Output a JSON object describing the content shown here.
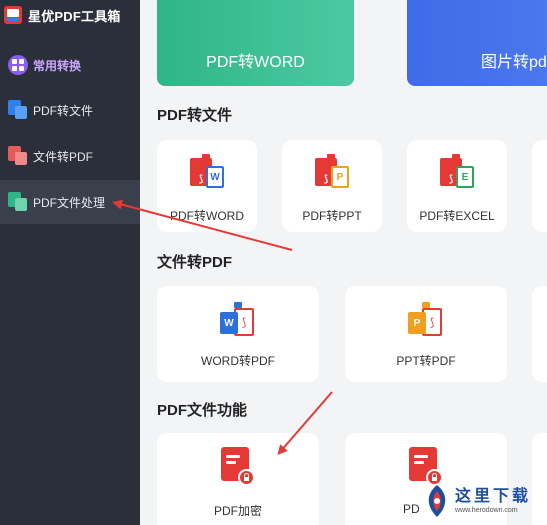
{
  "app": {
    "title": "星优PDF工具箱"
  },
  "sidebar": {
    "items": [
      {
        "label": "常用转换",
        "icon": "grid-icon"
      },
      {
        "label": "PDF转文件",
        "icon": "pdf-to-file-icon"
      },
      {
        "label": "文件转PDF",
        "icon": "file-to-pdf-icon"
      },
      {
        "label": "PDF文件处理",
        "icon": "pdf-process-icon"
      }
    ],
    "selected_index": 3
  },
  "banners": [
    {
      "label": "PDF转WORD",
      "color": "#2fb587"
    },
    {
      "label": "图片转pd",
      "color": "#3f6be8"
    }
  ],
  "sections": {
    "pdf_to_file": {
      "title": "PDF转文件",
      "cards": [
        {
          "label": "PDF转WORD",
          "badge": "W",
          "badge_color": "#2f6fd9"
        },
        {
          "label": "PDF转PPT",
          "badge": "P",
          "badge_color": "#f0a020"
        },
        {
          "label": "PDF转EXCEL",
          "badge": "E",
          "badge_color": "#2fa35a"
        }
      ]
    },
    "file_to_pdf": {
      "title": "文件转PDF",
      "cards": [
        {
          "label": "WORD转PDF",
          "badge": "W",
          "badge_color": "#2f6fd9"
        },
        {
          "label": "PPT转PDF",
          "badge": "P",
          "badge_color": "#f0a020"
        }
      ]
    },
    "pdf_functions": {
      "title": "PDF文件功能",
      "cards": [
        {
          "label": "PDF加密",
          "icon": "lock-doc-icon"
        },
        {
          "label": "PD",
          "icon": "key-doc-icon"
        }
      ]
    }
  },
  "colors": {
    "pdf_red": "#e53935",
    "sidebar_bg": "#2b2f3a",
    "accent_purple": "#8b5cf6",
    "arrow_red": "#e53935"
  },
  "watermark": {
    "text": "这里下载",
    "url": "www.herodown.com"
  }
}
